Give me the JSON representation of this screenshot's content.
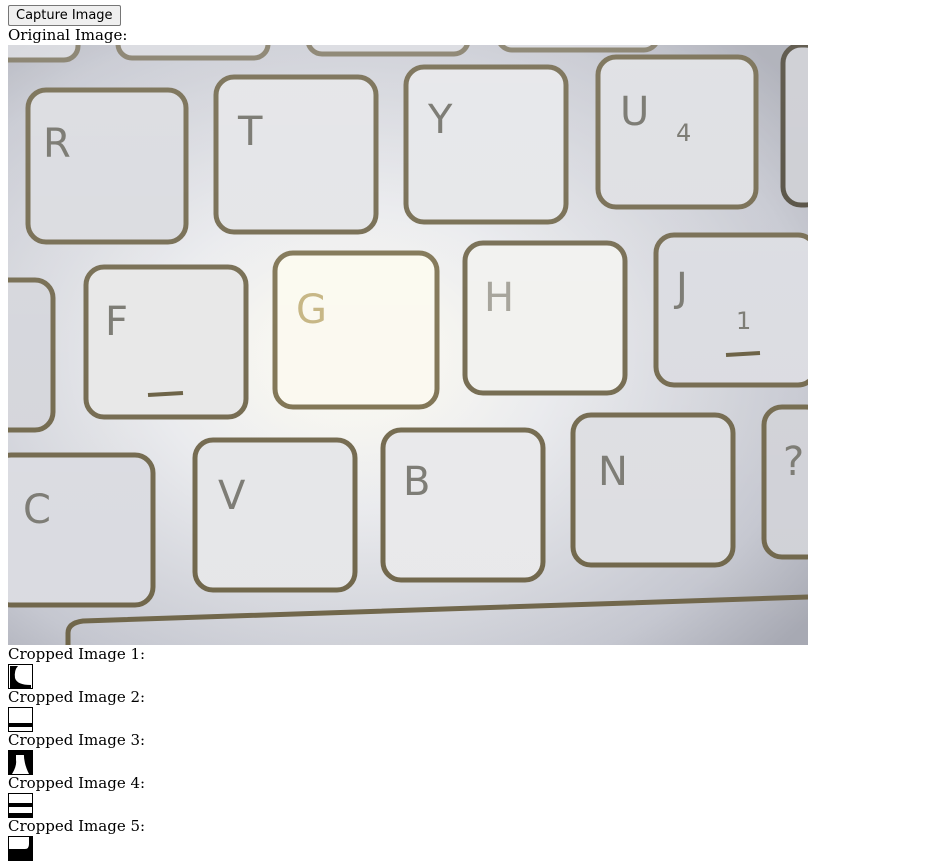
{
  "controls": {
    "capture_label": "Capture Image"
  },
  "original": {
    "label": "Original Image:",
    "keys": [
      "R",
      "T",
      "Y",
      "U",
      "4",
      "F",
      "G",
      "H",
      "J",
      "1",
      "C",
      "V",
      "B",
      "N",
      "?"
    ]
  },
  "crops": [
    {
      "label": "Cropped Image 1:"
    },
    {
      "label": "Cropped Image 2:"
    },
    {
      "label": "Cropped Image 3:"
    },
    {
      "label": "Cropped Image 4:"
    },
    {
      "label": "Cropped Image 5:"
    }
  ],
  "colors": {
    "key_outline": "#6e6448",
    "key_face": "#d9dbe0",
    "glow": "#fffdf2"
  }
}
